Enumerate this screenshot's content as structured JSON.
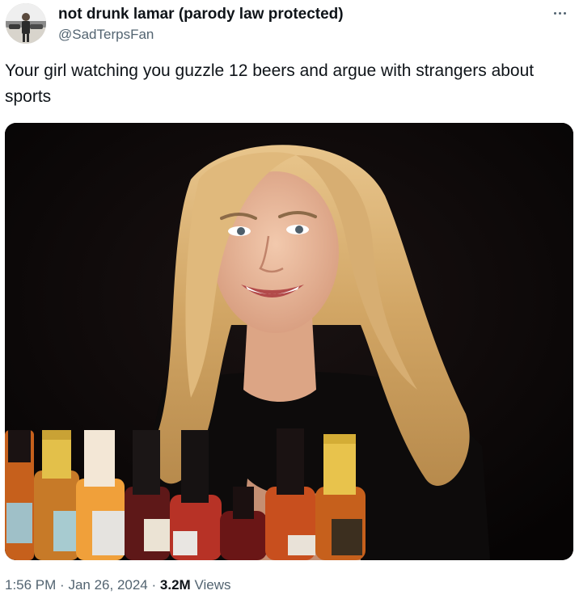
{
  "tweet": {
    "display_name": "not drunk lamar (parody law protected)",
    "handle": "@SadTerpsFan",
    "text": "Your girl watching you guzzle 12 beers and argue with strangers about sports",
    "more_icon": "more-horizontal-icon",
    "avatar_icon": "user-avatar"
  },
  "meta": {
    "time": "1:56 PM",
    "separator1": "·",
    "date": "Jan 26, 2024",
    "separator2": "·",
    "views_count": "3.2M",
    "views_label": "Views"
  },
  "colors": {
    "text_primary": "#0f1419",
    "text_secondary": "#536471",
    "media_background": "#0b0707"
  }
}
